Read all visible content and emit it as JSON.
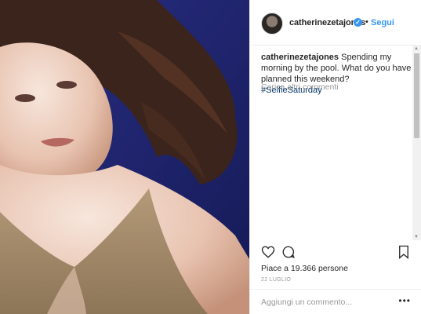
{
  "post": {
    "username": "catherinezetajones",
    "verified_mark": "✓",
    "separator": "•",
    "follow_label": "Segui",
    "caption_user": "catherinezetajones",
    "caption_text": " Spending my morning by the pool. What do you have planned this weekend? ",
    "caption_hashtag": "#SelfieSaturday",
    "load_more_label": "Carica altri commenti",
    "likes_text": "Piace a 19.366 persone",
    "date_label": "22 LUGLIO",
    "comment_placeholder": "Aggiungi un commento...",
    "more_options_label": "•••"
  },
  "icons": {
    "like": "heart-icon",
    "comment": "comment-bubble-icon",
    "save": "bookmark-icon",
    "verified": "verified-badge-icon"
  },
  "colors": {
    "accent": "#3897f0",
    "photo_background": "#24286f",
    "text": "#262626",
    "muted": "#999999"
  }
}
